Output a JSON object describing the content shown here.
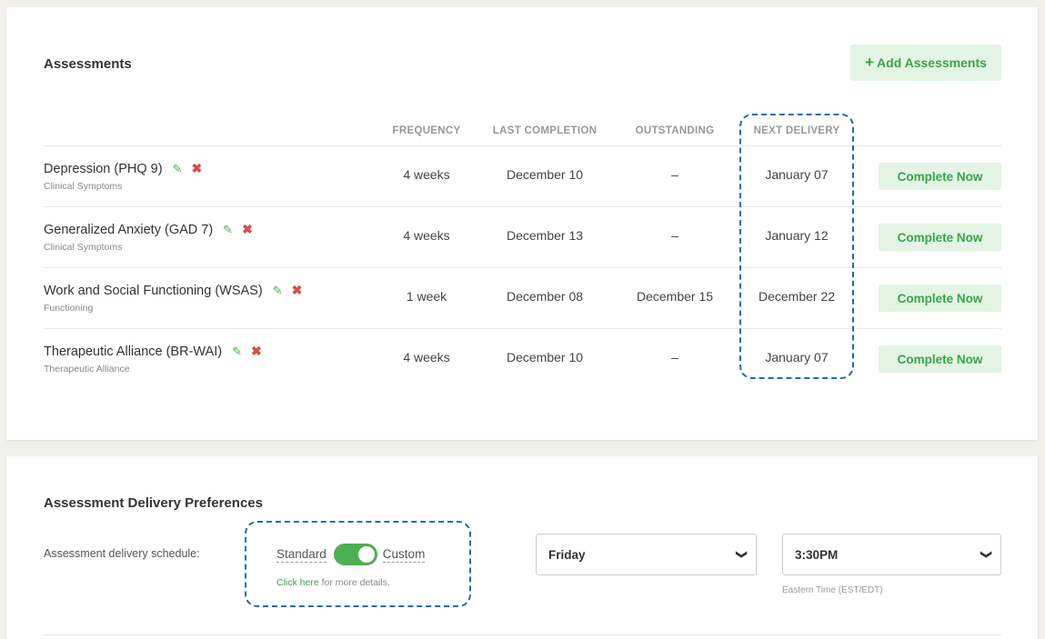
{
  "assessments": {
    "title": "Assessments",
    "add_button": "Add Assessments",
    "columns": {
      "frequency": "FREQUENCY",
      "last_completion": "LAST COMPLETION",
      "outstanding": "OUTSTANDING",
      "next_delivery": "NEXT DELIVERY"
    },
    "rows": [
      {
        "name": "Depression (PHQ 9)",
        "category": "Clinical Symptoms",
        "frequency": "4 weeks",
        "last_completion": "December 10",
        "outstanding": "–",
        "next_delivery": "January 07",
        "action": "Complete Now"
      },
      {
        "name": "Generalized Anxiety (GAD 7)",
        "category": "Clinical Symptoms",
        "frequency": "4 weeks",
        "last_completion": "December 13",
        "outstanding": "–",
        "next_delivery": "January 12",
        "action": "Complete Now"
      },
      {
        "name": "Work and Social Functioning (WSAS)",
        "category": "Functioning",
        "frequency": "1 week",
        "last_completion": "December 08",
        "outstanding": "December 15",
        "next_delivery": "December 22",
        "action": "Complete Now"
      },
      {
        "name": "Therapeutic Alliance (BR-WAI)",
        "category": "Therapeutic Alliance",
        "frequency": "4 weeks",
        "last_completion": "December 10",
        "outstanding": "–",
        "next_delivery": "January 07",
        "action": "Complete Now"
      }
    ]
  },
  "preferences": {
    "title": "Assessment Delivery Preferences",
    "schedule_label": "Assessment delivery schedule:",
    "toggle_left": "Standard",
    "toggle_right": "Custom",
    "toggle_state": "Custom",
    "details_link": "Click here",
    "details_rest": " for more details.",
    "day_select": "Friday",
    "time_select": "3:30PM",
    "timezone": "Eastern Time (EST/EDT)"
  },
  "colors": {
    "accent_green": "#4caf50",
    "button_bg": "#e3f4e4",
    "highlight_border": "#1a6fb0",
    "delete_red": "#d94b4b"
  }
}
